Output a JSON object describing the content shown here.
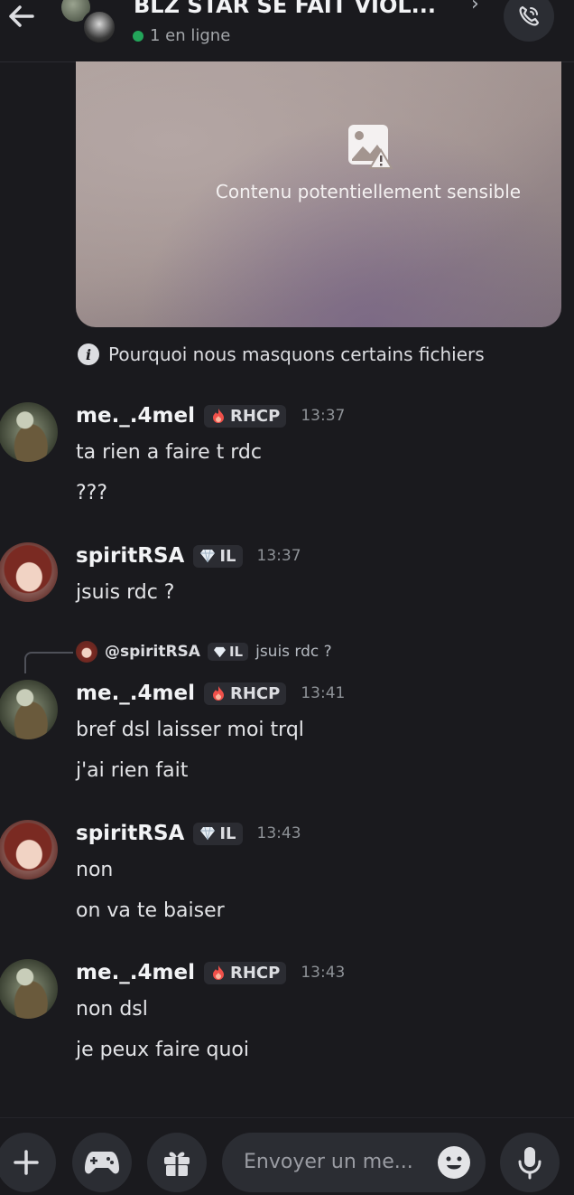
{
  "header": {
    "title": "BLZ STAR SE FAIT VIOL...",
    "chevron": "›",
    "status": "1 en ligne",
    "status_color": "#23a55a"
  },
  "attachment": {
    "sensitive_text": "Contenu potentiellement sensible",
    "icon": "image-warning-icon"
  },
  "why_link": "Pourquoi nous masquons certains fichiers",
  "messages": [
    {
      "author": "me._.4mel",
      "tag": "RHCP",
      "tag_icon": "fire-icon",
      "time": "13:37",
      "lines": [
        "ta rien a faire t rdc",
        "???"
      ]
    },
    {
      "author": "spiritRSA",
      "tag": "IL",
      "tag_icon": "diamond-icon",
      "time": "13:37",
      "lines": [
        "jsuis rdc ?"
      ]
    },
    {
      "author": "me._.4mel",
      "tag": "RHCP",
      "tag_icon": "fire-icon",
      "time": "13:41",
      "reply": {
        "author": "@spiritRSA",
        "tag": "IL",
        "text": "jsuis rdc ?"
      },
      "lines": [
        "bref dsl laisser moi trql",
        "j'ai rien fait"
      ]
    },
    {
      "author": "spiritRSA",
      "tag": "IL",
      "tag_icon": "diamond-icon",
      "time": "13:43",
      "lines": [
        "non",
        "on va te baiser"
      ]
    },
    {
      "author": "me._.4mel",
      "tag": "RHCP",
      "tag_icon": "fire-icon",
      "time": "13:43",
      "lines": [
        "non dsl",
        "je peux faire quoi"
      ]
    }
  ],
  "composer": {
    "placeholder": "Envoyer un me...",
    "buttons": [
      "plus-icon",
      "gamepad-icon",
      "gift-icon",
      "emoji-icon",
      "microphone-icon"
    ]
  }
}
